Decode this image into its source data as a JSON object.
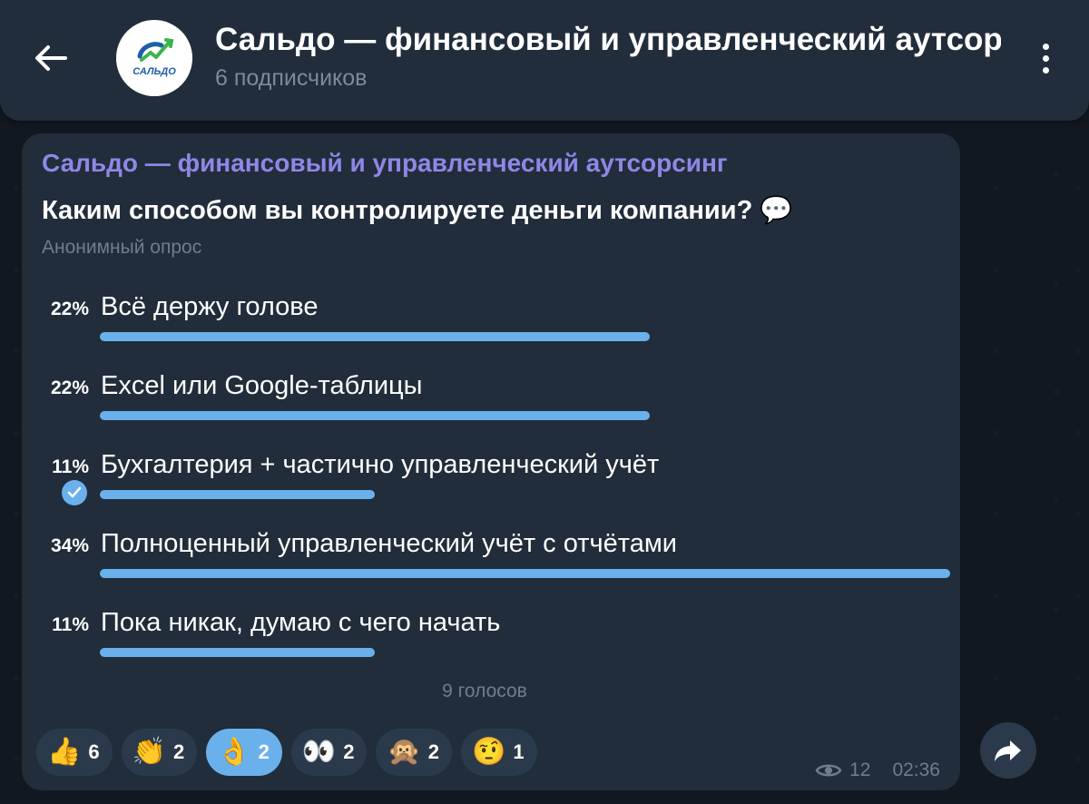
{
  "header": {
    "title": "Сальдо — финансовый и управленческий аутсорсинг",
    "subtitle": "6 подписчиков",
    "avatar_text": "САЛЬДО"
  },
  "post": {
    "sender": "Сальдо — финансовый и управленческий аутсорсинг",
    "question": "Каким способом вы контролируете деньги компании? 💬",
    "poll_type": "Анонимный опрос",
    "options": [
      {
        "percent": "22%",
        "label": "Всё держу  голове",
        "value": 22,
        "chosen": false
      },
      {
        "percent": "22%",
        "label": "Excel или Google-таблицы",
        "value": 22,
        "chosen": false
      },
      {
        "percent": "11%",
        "label": "Бухгалтерия + частично управленческий учёт",
        "value": 11,
        "chosen": true
      },
      {
        "percent": "34%",
        "label": "Полноценный управленческий учёт с отчётами",
        "value": 34,
        "chosen": false
      },
      {
        "percent": "11%",
        "label": "Пока никак, думаю с чего начать",
        "value": 11,
        "chosen": false
      }
    ],
    "votes": "9 голосов",
    "reactions": [
      {
        "emoji": "👍",
        "count": "6",
        "active": false
      },
      {
        "emoji": "👏",
        "count": "2",
        "active": false
      },
      {
        "emoji": "👌",
        "count": "2",
        "active": true
      },
      {
        "emoji": "👀",
        "count": "2",
        "active": false
      },
      {
        "emoji": "🙊",
        "count": "2",
        "active": false
      },
      {
        "emoji": "🤨",
        "count": "1",
        "active": false
      }
    ],
    "views": "12",
    "time": "02:36"
  },
  "icons": {
    "back": "arrow-left-icon",
    "menu": "more-vertical-icon",
    "check": "check-icon",
    "views": "eye-icon",
    "share": "share-icon"
  },
  "colors": {
    "accent": "#6ab1ec",
    "sender": "#8f87e6",
    "bubble": "#212d3b",
    "muted": "#6f7d8c"
  }
}
